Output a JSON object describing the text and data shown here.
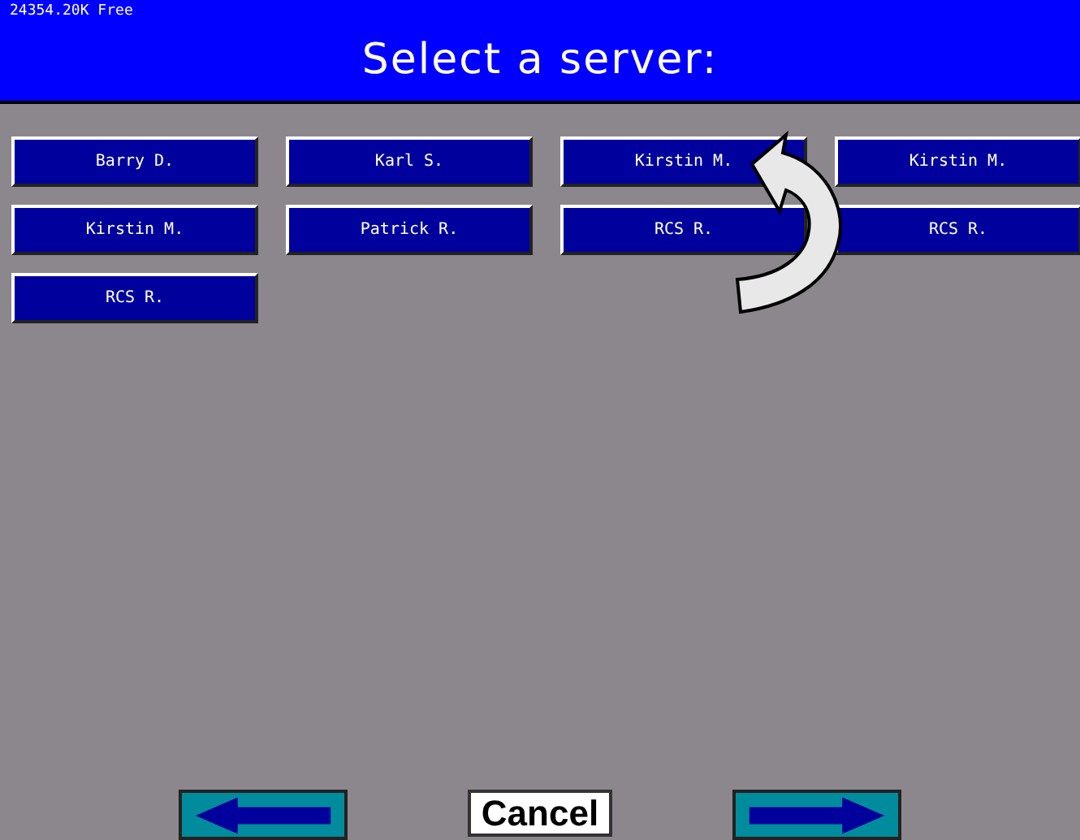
{
  "header": {
    "memory": "24354.20K Free",
    "title": "Select a server:"
  },
  "servers": [
    {
      "name": "Barry D."
    },
    {
      "name": "Karl S."
    },
    {
      "name": "Kirstin M."
    },
    {
      "name": "Kirstin M."
    },
    {
      "name": "Kirstin M."
    },
    {
      "name": "Patrick R."
    },
    {
      "name": "RCS R."
    },
    {
      "name": "RCS R."
    },
    {
      "name": "RCS R."
    }
  ],
  "footer": {
    "cancel": "Cancel"
  }
}
